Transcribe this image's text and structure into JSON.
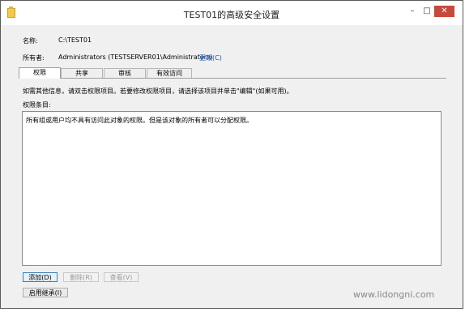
{
  "window": {
    "title": "TEST01的高级安全设置",
    "minimize_glyph": "–",
    "maximize_glyph": "□",
    "close_glyph": "✕"
  },
  "header": {
    "name_label": "名称:",
    "name_value": "C:\\TEST01",
    "owner_label": "所有者:",
    "owner_value": "Administrators (TESTSERVER01\\Administrators)",
    "change_link": "更改(C)"
  },
  "tabs": [
    {
      "label": "权限",
      "active": true
    },
    {
      "label": "共享",
      "active": false
    },
    {
      "label": "审核",
      "active": false
    },
    {
      "label": "有效访问",
      "active": false
    }
  ],
  "permissions": {
    "info_text": "如需其他信息，请双击权限项目。若要修改权限项目，请选择该项目并单击\"编辑\"(如果可用)。",
    "entries_label": "权限条目:",
    "empty_message": "所有组或用户均不具有访问此对象的权限。但是该对象的所有者可以分配权限。"
  },
  "buttons": {
    "add": "添加(D)",
    "remove": "删除(R)",
    "view": "查看(V)",
    "enable_inheritance": "启用继承(I)"
  },
  "watermark": "www.lidongni.com",
  "icons": {
    "app": "folder-icon"
  }
}
